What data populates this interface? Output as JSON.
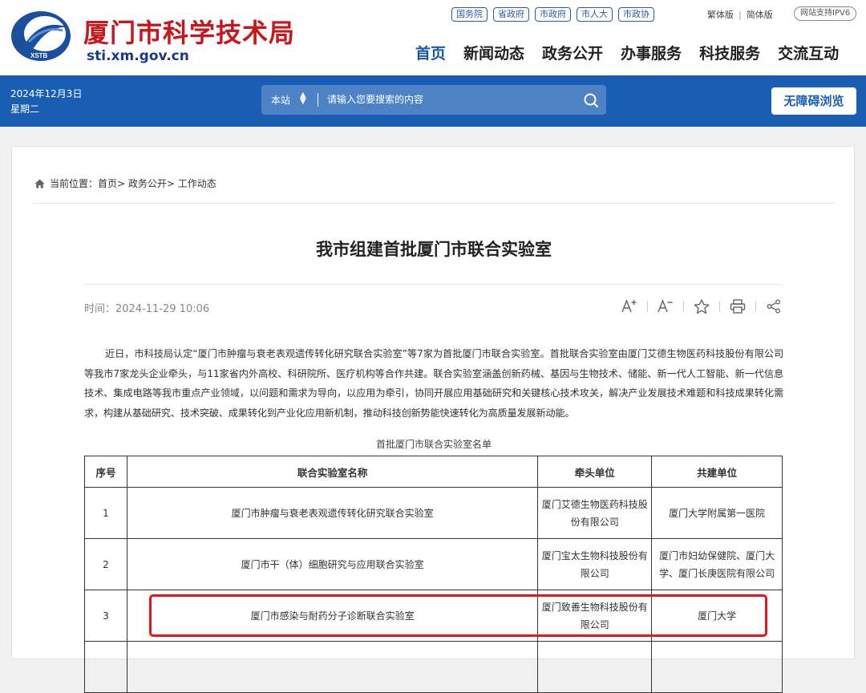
{
  "header": {
    "title": "厦门市科学技术局",
    "domain": "sti.xm.gov.cn",
    "logo_text": "XSTB",
    "top_links": [
      "国务院",
      "省政府",
      "市政府",
      "市人大",
      "市政协"
    ],
    "lang": {
      "traditional": "繁体版",
      "simplified": "简体版"
    },
    "ipv6": "网站支持IPV6",
    "nav": [
      "首页",
      "新闻动态",
      "政务公开",
      "办事服务",
      "科技服务",
      "交流互动"
    ]
  },
  "bar": {
    "date": "2024年12月3日",
    "weekday": "星期二",
    "search_scope": "本站",
    "search_placeholder": "请输入您要搜索的内容",
    "accessibility": "无障碍浏览"
  },
  "breadcrumb": {
    "label": "当前位置：",
    "path": "首页> 政务公开> 工作动态"
  },
  "article": {
    "title": "我市组建首批厦门市联合实验室",
    "time": "时间：2024-11-29 10:06",
    "body": "近日，市科技局认定“厦门市肿瘤与衰老表观遗传转化研究联合实验室”等7家为首批厦门市联合实验室。首批联合实验室由厦门艾德生物医药科技股份有限公司等我市7家龙头企业牵头，与11家省内外高校、科研院所、医疗机构等合作共建。联合实验室涵盖创新药械、基因与生物技术、储能、新一代人工智能、新一代信息技术、集成电路等我市重点产业领域，以问题和需求为导向，以应用为牵引，协同开展应用基础研究和关键核心技术攻关，解决产业发展技术难题和科技成果转化需求，构建从基础研究、技术突破、成果转化到产业化应用新机制，推动科技创新势能快速转化为高质量发展新动能。",
    "table_caption": "首批厦门市联合实验室名单",
    "table": {
      "headers": [
        "序号",
        "联合实验室名称",
        "牵头单位",
        "共建单位"
      ],
      "rows": [
        [
          "1",
          "厦门市肿瘤与衰老表观遗传转化研究联合实验室",
          "厦门艾德生物医药科技股份有限公司",
          "厦门大学附属第一医院"
        ],
        [
          "2",
          "厦门市干（体）细胞研究与应用联合实验室",
          "厦门宝太生物科技股份有限公司",
          "厦门市妇幼保健院、厦门大学、厦门长庚医院有限公司"
        ],
        [
          "3",
          "厦门市感染与耐药分子诊断联合实验室",
          "厦门致善生物科技股份有限公司",
          "厦门大学"
        ]
      ]
    }
  },
  "colors": {
    "brand_blue": "#1a5eb3",
    "brand_red": "#c8161d",
    "highlight": "#e8141b"
  },
  "icons": [
    "home-icon",
    "search-icon",
    "font-increase-icon",
    "font-decrease-icon",
    "star-icon",
    "print-icon",
    "share-icon"
  ]
}
